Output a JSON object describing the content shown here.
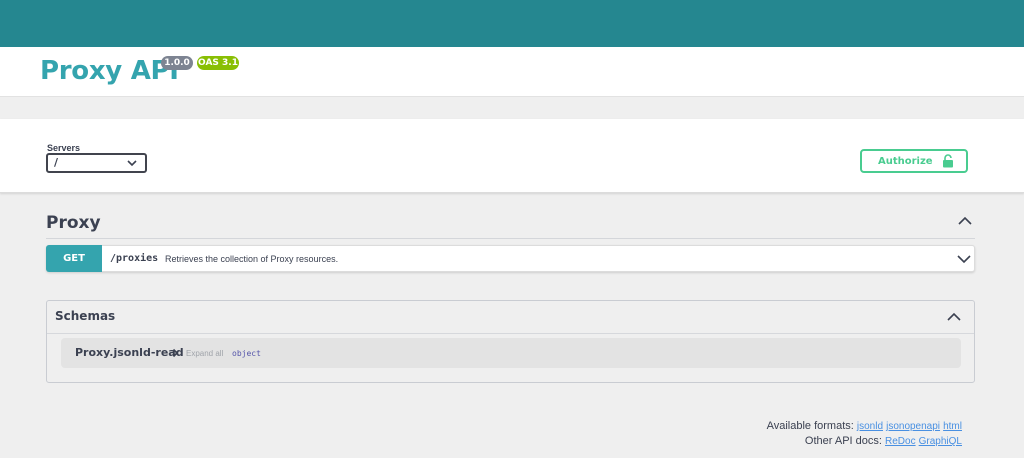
{
  "info": {
    "title": "Proxy API",
    "version": "1.0.0",
    "oas_version": "OAS 3.1"
  },
  "servers": {
    "label": "Servers",
    "selected": "/"
  },
  "authorize": {
    "label": "Authorize",
    "icon": "unlocked-lock-icon",
    "color": "#49cc90"
  },
  "tag": {
    "name": "Proxy",
    "icon": "chevron-up-icon"
  },
  "operations": [
    {
      "method": "GET",
      "method_color": "#34a4ae",
      "path": "/proxies",
      "summary": "Retrieves the collection of Proxy resources."
    }
  ],
  "schemas": {
    "title": "Schemas",
    "items": [
      {
        "name": "Proxy.jsonld-read",
        "expand_label": "Expand all",
        "type": "object"
      }
    ]
  },
  "footer": {
    "formats_label": "Available formats:",
    "formats": [
      "jsonld",
      "jsonopenapi",
      "html"
    ],
    "docs_label": "Other API docs:",
    "docs": [
      "ReDoc",
      "GraphiQL"
    ]
  },
  "colors": {
    "topbar": "#258790",
    "title": "#34a4ae",
    "version_badge": "#7d8492",
    "oas_badge": "#89bf04"
  }
}
